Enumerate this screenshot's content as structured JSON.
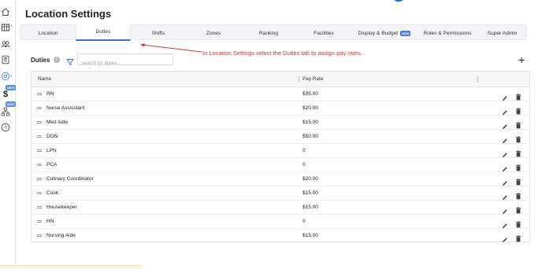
{
  "page": {
    "title": "Location Settings"
  },
  "sidebar": {
    "icons": [
      "home-icon",
      "grid-icon",
      "users-icon",
      "id-card-icon",
      "location-pin-icon",
      "dollar-icon",
      "hierarchy-icon",
      "help-icon"
    ],
    "badges": [
      "NEW",
      "NEW"
    ]
  },
  "tabs": [
    {
      "label": "Location",
      "active": false
    },
    {
      "label": "Duties",
      "active": true
    },
    {
      "label": "Shifts",
      "active": false
    },
    {
      "label": "Zones",
      "active": false
    },
    {
      "label": "Ranking",
      "active": false
    },
    {
      "label": "Facilities",
      "active": false
    },
    {
      "label": "Display & Budget",
      "active": false,
      "badge": "NEW"
    },
    {
      "label": "Roles & Permissions",
      "active": false
    },
    {
      "label": "Super Admin",
      "active": false
    }
  ],
  "annotation": {
    "text": "In Location Settings select the Duties tab to assign pay rates."
  },
  "duties": {
    "heading": "Duties",
    "info_glyph": "i",
    "search_placeholder": "Search for duties...",
    "add_glyph": "+",
    "columns": [
      "Name",
      "Pay Rate"
    ],
    "rows": [
      {
        "name": "RN",
        "pay_rate": "$35.00"
      },
      {
        "name": "Nurse Assisstant",
        "pay_rate": "$20.00"
      },
      {
        "name": "Med Aide",
        "pay_rate": "$15.00"
      },
      {
        "name": "DON",
        "pay_rate": "$50.00"
      },
      {
        "name": "LPN",
        "pay_rate": "0"
      },
      {
        "name": "PCA",
        "pay_rate": "0"
      },
      {
        "name": "Culinary Coordinator",
        "pay_rate": "$20.00"
      },
      {
        "name": "Cook",
        "pay_rate": "$15.00"
      },
      {
        "name": "Housekeeper",
        "pay_rate": "$15.00"
      },
      {
        "name": "HN",
        "pay_rate": "0"
      },
      {
        "name": "Nursing Aide",
        "pay_rate": "$15.00"
      }
    ]
  },
  "colors": {
    "accent": "#3b6fd8",
    "annotation": "#d9342b",
    "badge": "#4a7be8"
  }
}
